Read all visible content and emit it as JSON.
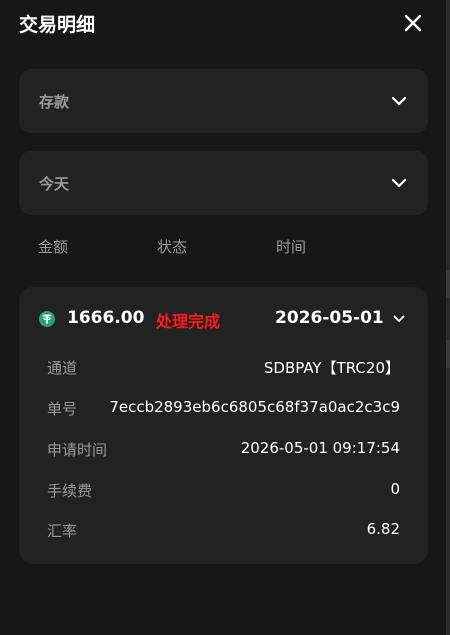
{
  "header": {
    "title": "交易明细"
  },
  "filters": {
    "type": {
      "selected": "存款"
    },
    "period": {
      "selected": "今天"
    }
  },
  "columns": {
    "amount": "金额",
    "status": "状态",
    "time": "时间"
  },
  "record": {
    "amount": "1666.00",
    "status": "处理完成",
    "date": "2026-05-01",
    "details": [
      {
        "label": "通道",
        "value": "SDBPAY【TRC20】"
      },
      {
        "label": "单号",
        "value": "7eccb2893eb6c6805c68f37a0ac2c3c9"
      },
      {
        "label": "申请时间",
        "value": "2026-05-01 09:17:54"
      },
      {
        "label": "手续费",
        "value": "0"
      },
      {
        "label": "汇率",
        "value": "6.82"
      }
    ]
  },
  "colors": {
    "status": "#ff1a1a",
    "coin": "#26a17b",
    "card": "#222222",
    "background": "#171717"
  },
  "icons": {
    "close": "close-icon",
    "chevron": "chevron-down-icon",
    "coin": "usdt-tether-icon"
  }
}
